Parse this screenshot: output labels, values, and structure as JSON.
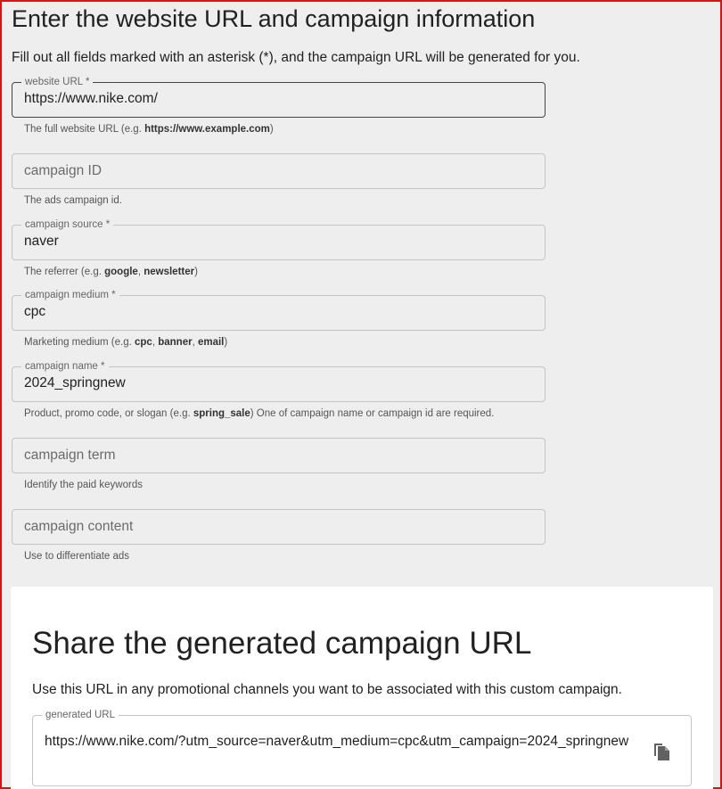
{
  "form": {
    "title": "Enter the website URL and campaign information",
    "subtitle": "Fill out all fields marked with an asterisk (*), and the campaign URL will be generated for you.",
    "website_url": {
      "label": "website URL *",
      "value": "https://www.nike.com/",
      "helper_prefix": "The full website URL (e.g. ",
      "helper_bold": "https://www.example.com",
      "helper_suffix": ")"
    },
    "campaign_id": {
      "placeholder": "campaign ID",
      "helper": "The ads campaign id."
    },
    "campaign_source": {
      "label": "campaign source *",
      "value": "naver",
      "helper_prefix": "The referrer (e.g. ",
      "helper_bold_1": "google",
      "helper_sep": ", ",
      "helper_bold_2": "newsletter",
      "helper_suffix": ")"
    },
    "campaign_medium": {
      "label": "campaign medium *",
      "value": "cpc",
      "helper_prefix": "Marketing medium (e.g. ",
      "helper_bold_1": "cpc",
      "helper_sep1": ", ",
      "helper_bold_2": "banner",
      "helper_sep2": ", ",
      "helper_bold_3": "email",
      "helper_suffix": ")"
    },
    "campaign_name": {
      "label": "campaign name *",
      "value": "2024_springnew",
      "helper_prefix": "Product, promo code, or slogan (e.g. ",
      "helper_bold": "spring_sale",
      "helper_suffix": ") One of campaign name or campaign id are required."
    },
    "campaign_term": {
      "placeholder": "campaign term",
      "helper": "Identify the paid keywords"
    },
    "campaign_content": {
      "placeholder": "campaign content",
      "helper": "Use to differentiate ads"
    }
  },
  "share": {
    "title": "Share the generated campaign URL",
    "subtitle": "Use this URL in any promotional channels you want to be associated with this custom campaign.",
    "generated_label": "generated URL",
    "generated_url": "https://www.nike.com/?utm_source=naver&utm_medium=cpc&utm_campaign=2024_springnew",
    "copy_icon": "copy-icon"
  }
}
